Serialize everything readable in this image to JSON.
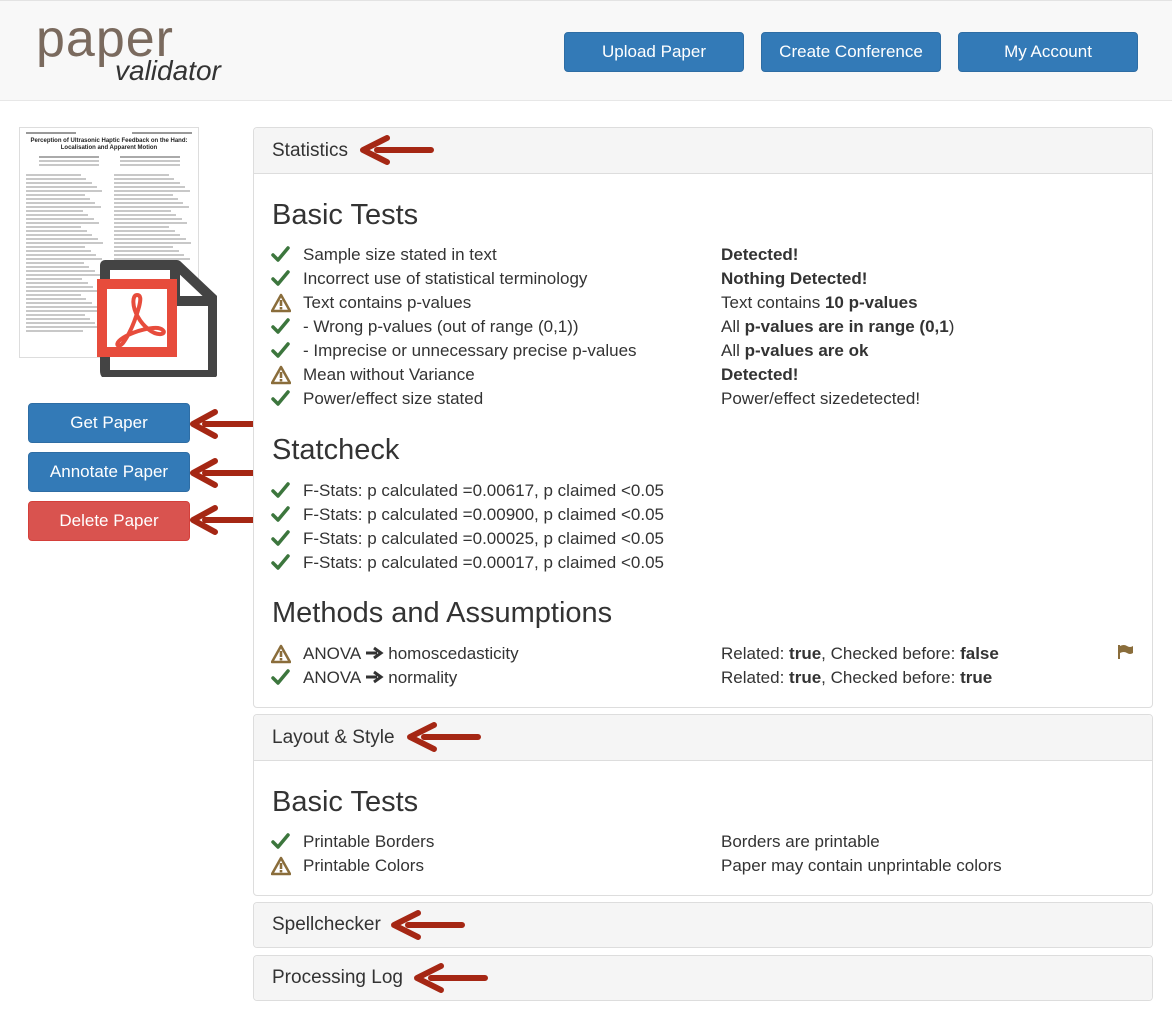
{
  "header": {
    "logo_main": "paper",
    "logo_sub": "validator",
    "nav": [
      {
        "label": "Upload Paper"
      },
      {
        "label": "Create Conference"
      },
      {
        "label": "My Account"
      }
    ]
  },
  "thumbnail": {
    "title": "Perception of Ultrasonic Haptic Feedback on the Hand: Localisation and Apparent Motion"
  },
  "sidebar": {
    "buttons": [
      {
        "label": "Get Paper",
        "color": "#337ab7"
      },
      {
        "label": "Annotate Paper",
        "color": "#337ab7"
      },
      {
        "label": "Delete Paper",
        "color": "#d9534f"
      }
    ]
  },
  "statistics": {
    "heading": "Statistics",
    "basic_tests": {
      "title": "Basic Tests",
      "rows": [
        {
          "status": "ok",
          "label": "Sample size stated in text",
          "result_pre": "",
          "result_bold": "Detected!",
          "result_post": "",
          "result_bold2": "",
          "result_post2": ""
        },
        {
          "status": "ok",
          "label": "Incorrect use of statistical terminology",
          "result_pre": "",
          "result_bold": "Nothing Detected!",
          "result_post": "",
          "result_bold2": "",
          "result_post2": ""
        },
        {
          "status": "warn",
          "label": "Text contains p-values",
          "result_pre": "Text contains ",
          "result_bold": "10 p-values",
          "result_post": "",
          "result_bold2": "",
          "result_post2": ""
        },
        {
          "status": "ok",
          "label": "- Wrong p-values (out of range (0,1))",
          "result_pre": "All ",
          "result_bold": "p-values are in range (0,1",
          "result_post": ")",
          "result_bold2": "",
          "result_post2": ""
        },
        {
          "status": "ok",
          "label": "- Imprecise or unnecessary precise p-values",
          "result_pre": "All ",
          "result_bold": "p-values are ok",
          "result_post": "",
          "result_bold2": "",
          "result_post2": ""
        },
        {
          "status": "warn",
          "label": "Mean without Variance",
          "result_pre": "",
          "result_bold": "Detected!",
          "result_post": "",
          "result_bold2": "",
          "result_post2": ""
        },
        {
          "status": "ok",
          "label": "Power/effect size stated",
          "result_pre": "Power/effect sizedetected!",
          "result_bold": "",
          "result_post": "",
          "result_bold2": "",
          "result_post2": ""
        }
      ]
    },
    "statcheck": {
      "title": "Statcheck",
      "rows": [
        {
          "status": "ok",
          "label": "F-Stats: p calculated =0.00617, p claimed <0.05"
        },
        {
          "status": "ok",
          "label": "F-Stats: p calculated =0.00900, p claimed <0.05"
        },
        {
          "status": "ok",
          "label": "F-Stats: p calculated =0.00025, p claimed <0.05"
        },
        {
          "status": "ok",
          "label": "F-Stats: p calculated =0.00017, p claimed <0.05"
        }
      ]
    },
    "methods": {
      "title": "Methods and Assumptions",
      "rows": [
        {
          "status": "warn",
          "method": "ANOVA",
          "assumption": "homoscedasticity",
          "related_label": "Related: ",
          "related": "true",
          "checked_label": ", Checked before: ",
          "checked": "false",
          "flag": true
        },
        {
          "status": "ok",
          "method": "ANOVA",
          "assumption": "normality",
          "related_label": "Related: ",
          "related": "true",
          "checked_label": ", Checked before: ",
          "checked": "true",
          "flag": false
        }
      ]
    }
  },
  "layout_style": {
    "heading": "Layout & Style",
    "basic_tests": {
      "title": "Basic Tests",
      "rows": [
        {
          "status": "ok",
          "label": "Printable Borders",
          "result": "Borders are printable"
        },
        {
          "status": "warn",
          "label": "Printable Colors",
          "result": "Paper may contain unprintable colors"
        }
      ]
    }
  },
  "spellchecker": {
    "heading": "Spellchecker"
  },
  "processing_log": {
    "heading": "Processing Log"
  },
  "colors": {
    "primary": "#337ab7",
    "danger": "#d9534f",
    "ok_icon": "#3c763d",
    "warn_icon": "#8a6d3b",
    "annotation_arrow": "#a52714"
  }
}
